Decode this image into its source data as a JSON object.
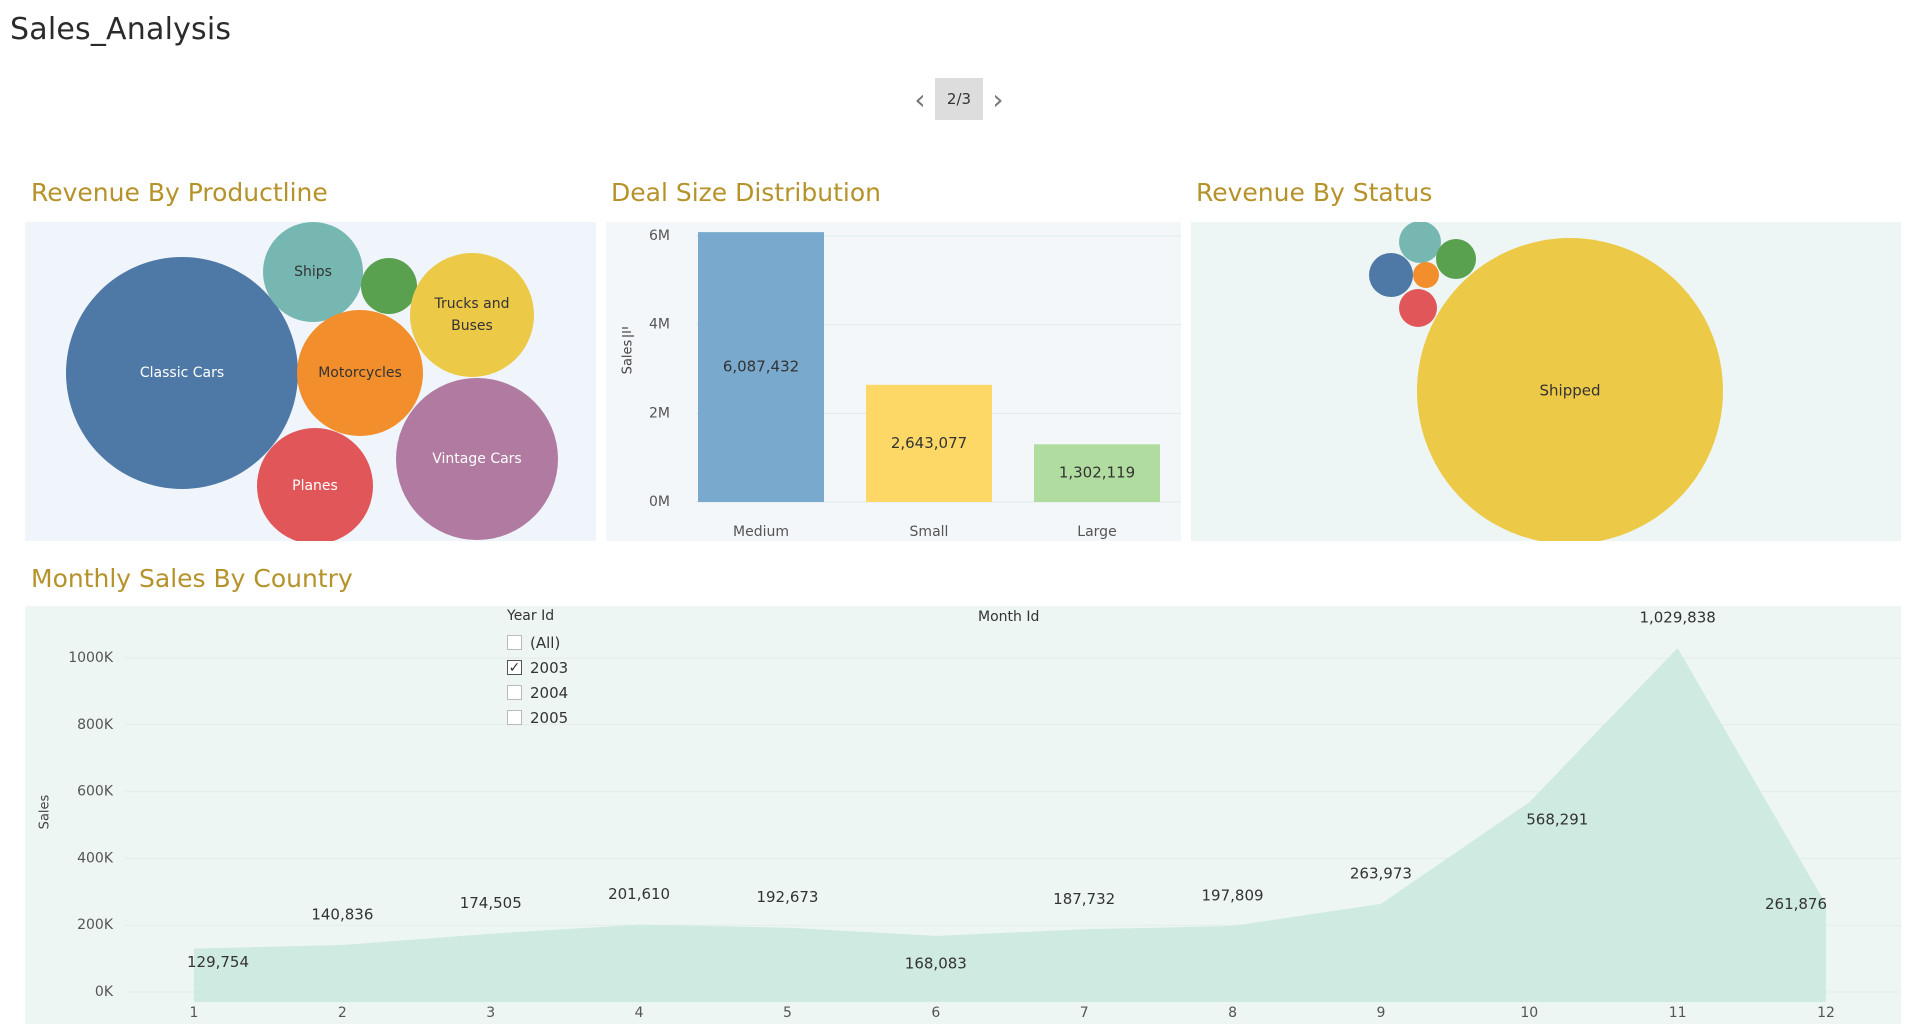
{
  "app": {
    "title": "Sales_Analysis"
  },
  "pager": {
    "label": "2/3",
    "prev_icon": "chevron-left-icon",
    "next_icon": "chevron-right-icon"
  },
  "panels": {
    "productline": {
      "title": "Revenue By Productline",
      "bg": "#eff5fa"
    },
    "dealsize": {
      "title": "Deal Size Distribution",
      "bg": "#f3f7f9"
    },
    "status": {
      "title": "Revenue By Status",
      "bg": "#edf6f4"
    },
    "monthly": {
      "title": "Monthly Sales By Country",
      "bg": "#eef6f3"
    }
  },
  "filter": {
    "title": "Year Id",
    "options": [
      {
        "label": "(All)",
        "checked": false
      },
      {
        "label": "2003",
        "checked": true
      },
      {
        "label": "2004",
        "checked": false
      },
      {
        "label": "2005",
        "checked": false
      }
    ]
  },
  "month_header": "Month Id",
  "colors": {
    "title": "#b5922a",
    "classic_cars": "#4e79a7",
    "ships": "#76b7b2",
    "trains": "#59a14f",
    "trucks": "#edc948",
    "motorcycles": "#f28e2b",
    "vintage_cars": "#b07aa1",
    "planes": "#e15759",
    "medium": "#7aa9ce",
    "small": "#fdd866",
    "large": "#b1dc9f",
    "area": "#cfeae1"
  },
  "chart_data": [
    {
      "type": "bubble",
      "bubbles": [
        {
          "label": "Classic Cars",
          "color": "#4e79a7",
          "text_color": "#ffffff"
        },
        {
          "label": "Ships",
          "color": "#76b7b2",
          "text_color": "#333333"
        },
        {
          "label": "",
          "color": "#59a14f",
          "text_color": "#ffffff"
        },
        {
          "label": "Trucks and\nBuses",
          "color": "#edc948",
          "text_color": "#333333"
        },
        {
          "label": "Motorcycles",
          "color": "#f28e2b",
          "text_color": "#333333"
        },
        {
          "label": "Vintage Cars",
          "color": "#b07aa1",
          "text_color": "#ffffff"
        },
        {
          "label": "Planes",
          "color": "#e15759",
          "text_color": "#ffffff"
        }
      ]
    },
    {
      "type": "bar",
      "categories": [
        "Medium",
        "Small",
        "Large"
      ],
      "values": [
        6087432,
        2643077,
        1302119
      ],
      "data_labels": [
        "6,087,432",
        "2,643,077",
        "1,302,119"
      ],
      "colors": [
        "#7aa9ce",
        "#fdd866",
        "#b1dc9f"
      ],
      "ylabel": "Sales",
      "ylim": [
        0,
        6000000
      ],
      "yticks": [
        0,
        2000000,
        4000000,
        6000000
      ],
      "ytick_labels": [
        "0M",
        "2M",
        "4M",
        "6M"
      ],
      "grid": true
    },
    {
      "type": "bubble",
      "bubbles": [
        {
          "label": "Shipped",
          "color": "#edc948",
          "text_color": "#333333"
        },
        {
          "label": "",
          "color": "#76b7b2"
        },
        {
          "label": "",
          "color": "#59a14f"
        },
        {
          "label": "",
          "color": "#4e79a7"
        },
        {
          "label": "",
          "color": "#f28e2b"
        },
        {
          "label": "",
          "color": "#e15759"
        }
      ]
    },
    {
      "type": "area",
      "x": [
        1,
        2,
        3,
        4,
        5,
        6,
        7,
        8,
        9,
        10,
        11,
        12
      ],
      "values": [
        129754,
        140836,
        174505,
        201610,
        192673,
        168083,
        187732,
        197809,
        263973,
        568291,
        1029838,
        261876
      ],
      "data_labels": [
        "129,754",
        "140,836",
        "174,505",
        "201,610",
        "192,673",
        "168,083",
        "187,732",
        "197,809",
        "263,973",
        "568,291",
        "1,029,838",
        "261,876"
      ],
      "ylabel": "Sales",
      "ylim": [
        0,
        1000000
      ],
      "yticks": [
        0,
        200000,
        400000,
        600000,
        800000,
        1000000
      ],
      "ytick_labels": [
        "0K",
        "200K",
        "400K",
        "600K",
        "800K",
        "1000K"
      ],
      "color": "#cfeae1",
      "grid": true
    }
  ]
}
